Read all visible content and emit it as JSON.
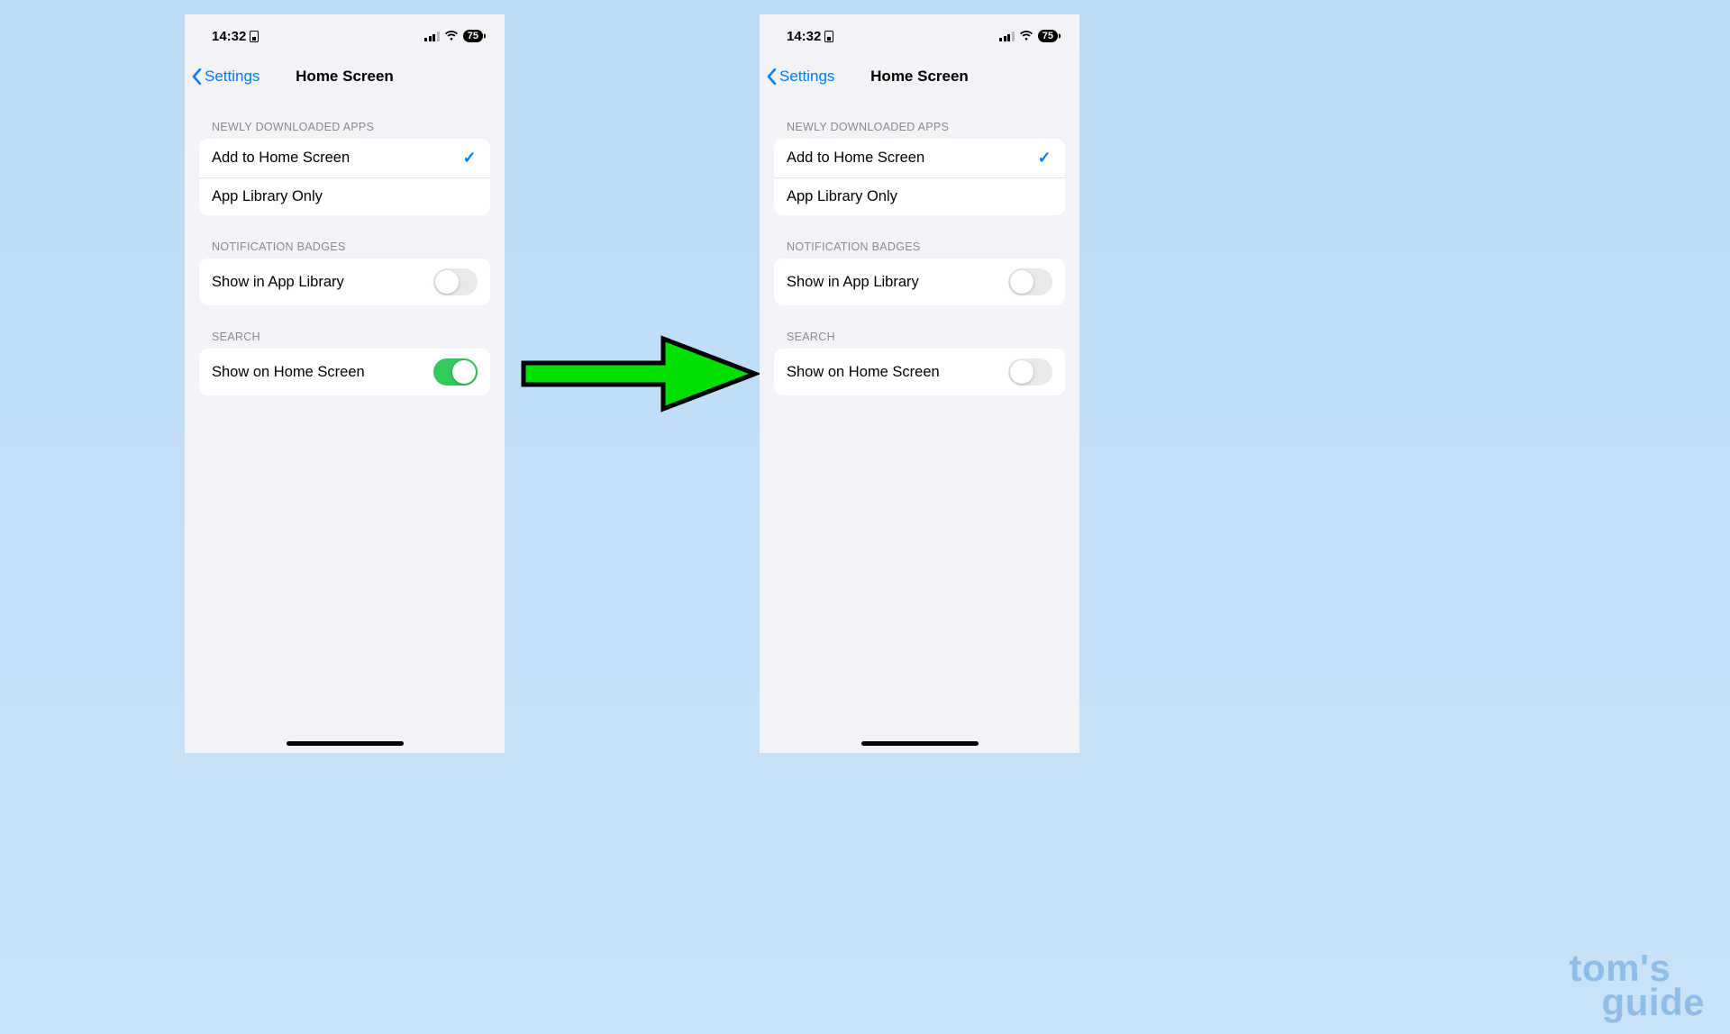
{
  "status": {
    "time": "14:32",
    "battery": "75"
  },
  "nav": {
    "back": "Settings",
    "title": "Home Screen"
  },
  "sections": {
    "newly_downloaded": {
      "header": "NEWLY DOWNLOADED APPS",
      "opt1": "Add to Home Screen",
      "opt2": "App Library Only"
    },
    "badges": {
      "header": "NOTIFICATION BADGES",
      "row": "Show in App Library"
    },
    "search": {
      "header": "SEARCH",
      "row": "Show on Home Screen"
    }
  },
  "watermark": {
    "line1": "tom's",
    "line2": "guide"
  }
}
